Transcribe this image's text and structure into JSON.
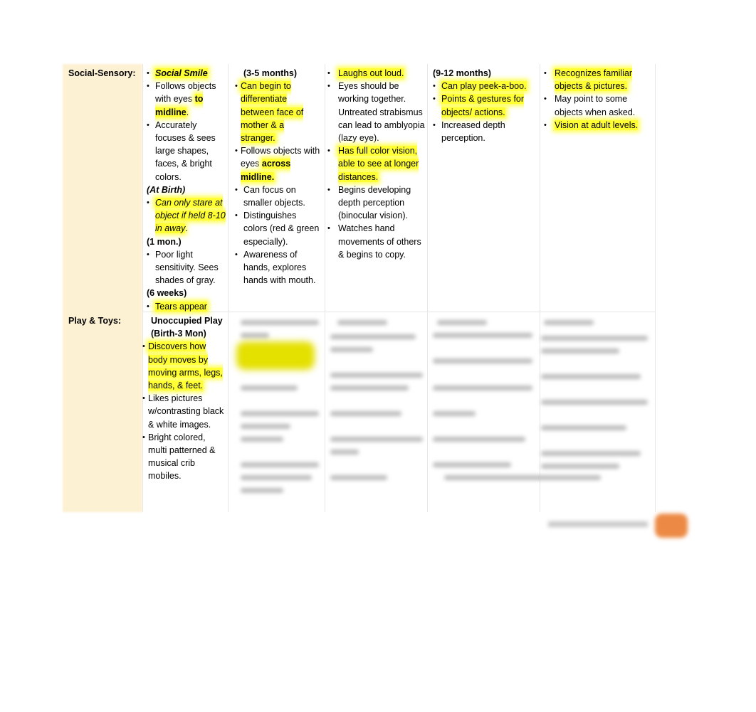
{
  "rows": {
    "social_sensory": {
      "label": "Social-Sensory:",
      "col1": {
        "items": [
          {
            "text": "Social Smile"
          },
          {
            "pre": "Follows objects with eyes ",
            "bold": "to midline",
            "post": "."
          },
          {
            "text": "Accurately focuses & sees large shapes, faces, & bright colors."
          }
        ],
        "age_birth": "(At Birth)",
        "item_birth": "Can only stare at object if held 8-10 in away",
        "item_birth_post": ".",
        "age_1mon": "(1 mon.)",
        "item_1mon": "Poor light sensitivity. Sees shades of gray.",
        "age_6wk": "(6 weeks)",
        "item_6wk": "Tears appear"
      },
      "col2": {
        "header": "(3-5 months)",
        "items": [
          {
            "text": "Can begin to differentiate between face of mother & a stranger."
          },
          {
            "pre": "Follows objects with eyes ",
            "bold": "across midline."
          },
          {
            "text": "Can focus on smaller objects."
          },
          {
            "text": "Distinguishes colors (red & green especially)."
          },
          {
            "text": "Awareness of hands, explores hands with mouth."
          }
        ]
      },
      "col3": {
        "items": [
          {
            "text": "Laughs out loud."
          },
          {
            "text": "Eyes should be working together. Untreated strabismus can lead to amblyopia (lazy eye)."
          },
          {
            "text": "Has full color vision, able to see at longer distances."
          },
          {
            "text": "Begins developing depth perception (binocular vision)."
          },
          {
            "text": "Watches hand movements of others & begins to copy."
          }
        ]
      },
      "col4": {
        "header": "(9-12 months)",
        "items": [
          {
            "text": "Can play peek-a-boo."
          },
          {
            "text": "Points & gestures for objects/ actions."
          },
          {
            "text": "Increased depth perception."
          }
        ]
      },
      "col5": {
        "items": [
          {
            "text": "Recognizes familiar objects & pictures."
          },
          {
            "text": "May point to some objects when asked."
          },
          {
            "text": "Vision at adult levels."
          }
        ]
      }
    },
    "play_toys": {
      "label": "Play & Toys:",
      "col1": {
        "header": "Unoccupied Play (Birth-3 Mon)",
        "items": [
          {
            "text": "Discovers how body moves by moving arms, legs, hands, & feet."
          },
          {
            "text": "Likes pictures w/contrasting black & white images."
          },
          {
            "text": "Bright colored, multi patterned & musical crib mobiles."
          }
        ]
      }
    }
  },
  "colors": {
    "label_column_bg": "#fdf1d3",
    "highlight": "#ffff33",
    "accent_button": "#ec8a45"
  }
}
